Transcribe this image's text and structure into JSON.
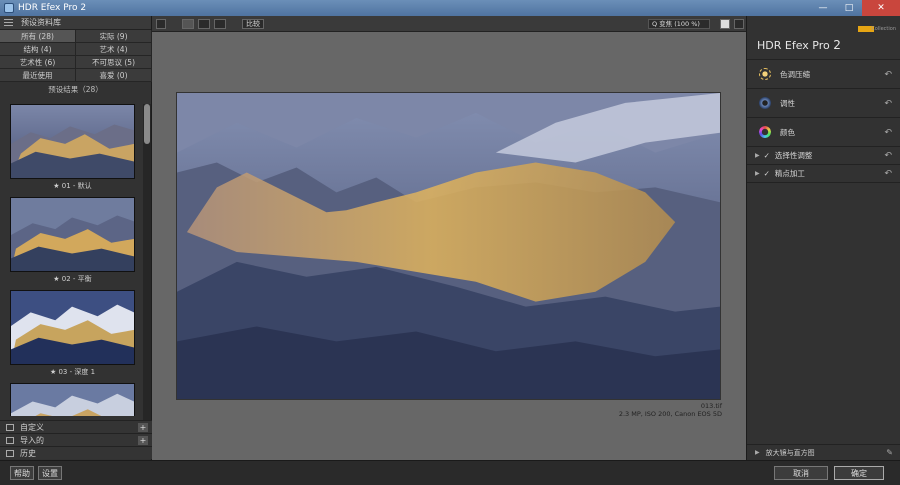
{
  "window": {
    "title": "HDR Efex Pro 2"
  },
  "left_panel": {
    "header": "预设资料库",
    "categories": [
      {
        "label": "所有 (28)",
        "selected": true
      },
      {
        "label": "实际 (9)",
        "selected": false
      },
      {
        "label": "结构 (4)",
        "selected": false
      },
      {
        "label": "艺术 (4)",
        "selected": false
      },
      {
        "label": "艺术性 (6)",
        "selected": false
      },
      {
        "label": "不可思议 (5)",
        "selected": false
      },
      {
        "label": "最近使用",
        "selected": false
      },
      {
        "label": "喜爱 (0)",
        "selected": false
      }
    ],
    "preset_count": "预设结果（28）",
    "presets": [
      {
        "label": "★ 01 - 默认"
      },
      {
        "label": "★ 02 - 平衡"
      },
      {
        "label": "★ 03 - 深度 1"
      },
      {
        "label": ""
      }
    ],
    "bottom_rows": [
      {
        "label": "自定义",
        "icon": "custom-icon"
      },
      {
        "label": "导入的",
        "icon": "import-icon"
      },
      {
        "label": "历史",
        "icon": "history-icon"
      }
    ]
  },
  "toolbar": {
    "compare_label": "比较",
    "zoom_label": "Q 变焦 (100 %)"
  },
  "canvas": {
    "filename": "013.tif",
    "file_info": "2.3 MP, ISO 200, Canon EOS 5D"
  },
  "right_panel": {
    "brand": "HDR Efex Pro",
    "brand_version": "2",
    "brand_collection": "Collection",
    "sections": [
      {
        "label": "色调压缩",
        "icon": "sun-icon"
      },
      {
        "label": "调性",
        "icon": "tonality-icon"
      },
      {
        "label": "颜色",
        "icon": "color-wheel-icon"
      }
    ],
    "small_sections": [
      {
        "label": "选择性调整"
      },
      {
        "label": "精点加工"
      }
    ],
    "footer": "放大镜与直方图"
  },
  "bottom": {
    "help": "帮助",
    "settings": "设置",
    "cancel": "取消",
    "ok": "确定"
  },
  "colors": {
    "accent": "#e6a514",
    "close": "#c9463d"
  }
}
